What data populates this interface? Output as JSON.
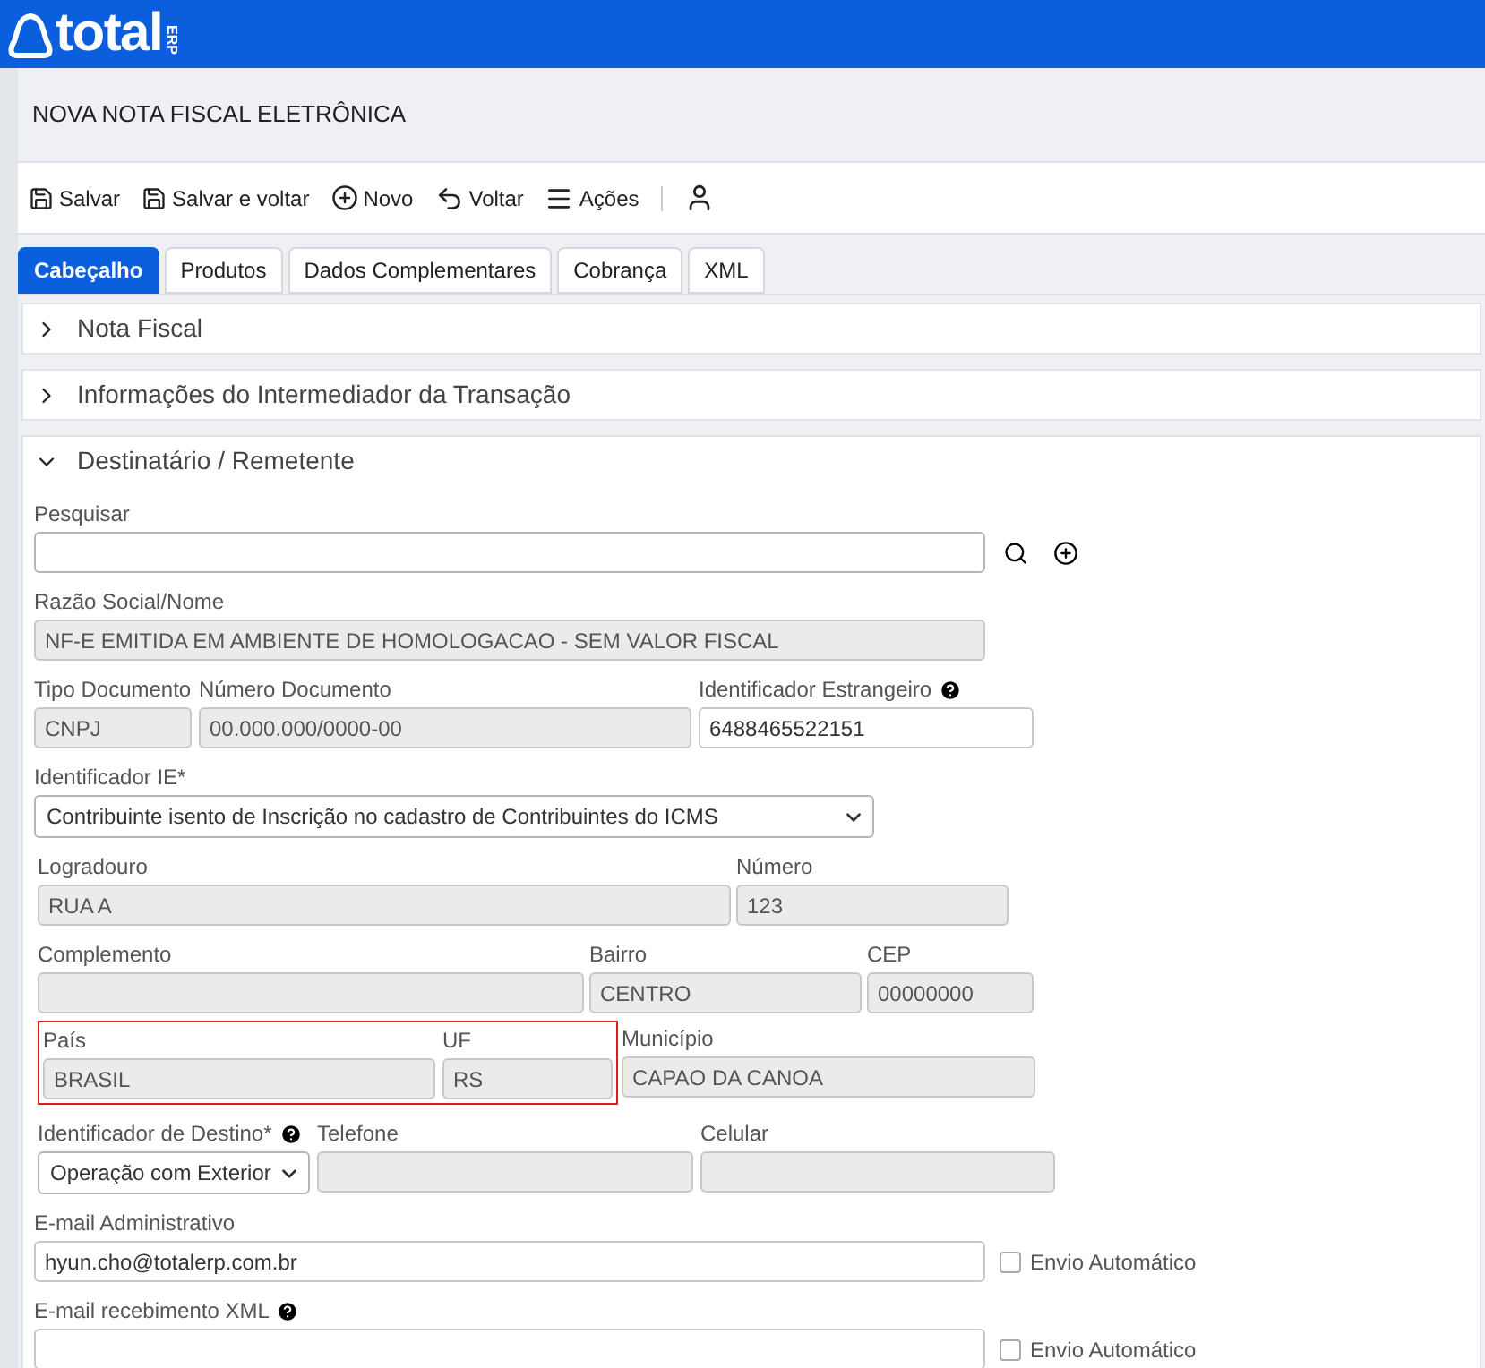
{
  "brand": {
    "name": "total",
    "suffix": "ERP"
  },
  "page_title": "NOVA NOTA FISCAL ELETRÔNICA",
  "toolbar": [
    {
      "kind": "save",
      "label": "Salvar"
    },
    {
      "kind": "save",
      "label": "Salvar e voltar"
    },
    {
      "kind": "new",
      "label": "Novo"
    },
    {
      "kind": "back",
      "label": "Voltar"
    },
    {
      "kind": "menu",
      "label": "Ações"
    },
    {
      "kind": "user"
    }
  ],
  "tabs": [
    {
      "label": "Cabeçalho",
      "selected": true
    },
    {
      "label": "Produtos",
      "selected": false
    },
    {
      "label": "Dados Complementares",
      "selected": false
    },
    {
      "label": "Cobrança",
      "selected": false
    },
    {
      "label": "XML",
      "selected": false
    }
  ],
  "sections": [
    {
      "title": "Nota Fiscal",
      "expanded": false
    },
    {
      "title": "Informações do Intermediador da Transação",
      "expanded": false
    },
    {
      "title": "Destinatário / Remetente",
      "expanded": true
    }
  ],
  "form": {
    "search": {
      "label": "Pesquisar"
    },
    "razao": {
      "label": "Razão Social/Nome",
      "value": "NF-E EMITIDA EM AMBIENTE DE HOMOLOGACAO - SEM VALOR FISCAL",
      "disabled": true
    },
    "tipo_doc": {
      "label": "Tipo Documento",
      "value": "CNPJ",
      "disabled": true
    },
    "numero_doc": {
      "label": "Número Documento",
      "value": "00.000.000/0000-00",
      "disabled": true
    },
    "id_estrangeiro": {
      "label": "Identificador Estrangeiro",
      "value": "6488465522151",
      "disabled": false
    },
    "id_ie": {
      "label": "Identificador IE*",
      "value": "Contribuinte isento de Inscrição no cadastro de Contribuintes do ICMS"
    },
    "logradouro": {
      "label": "Logradouro",
      "value": "RUA A",
      "disabled": true
    },
    "numero": {
      "label": "Número",
      "value": "123",
      "disabled": true
    },
    "complemento": {
      "label": "Complemento",
      "disabled": true
    },
    "bairro": {
      "label": "Bairro",
      "value": "CENTRO",
      "disabled": true
    },
    "cep": {
      "label": "CEP",
      "value": "00000000",
      "disabled": true
    },
    "pais": {
      "label": "País",
      "value": "BRASIL",
      "disabled": true
    },
    "uf": {
      "label": "UF",
      "value": "RS",
      "disabled": true
    },
    "pais_uf_highlighted": true,
    "municipio": {
      "label": "Município",
      "value": "CAPAO DA CANOA",
      "disabled": true
    },
    "id_destino": {
      "label": "Identificador de Destino*",
      "value": "Operação com Exterior"
    },
    "telefone": {
      "label": "Telefone",
      "disabled": true
    },
    "celular": {
      "label": "Celular",
      "disabled": true
    },
    "email_admin": {
      "label": "E-mail Administrativo",
      "value": "hyun.cho@totalerp.com.br",
      "disabled": false,
      "auto_label": "Envio Automático",
      "auto_checked": false
    },
    "email_xml": {
      "label": "E-mail recebimento XML",
      "disabled": false,
      "auto_label": "Envio Automático",
      "auto_checked": false
    }
  }
}
